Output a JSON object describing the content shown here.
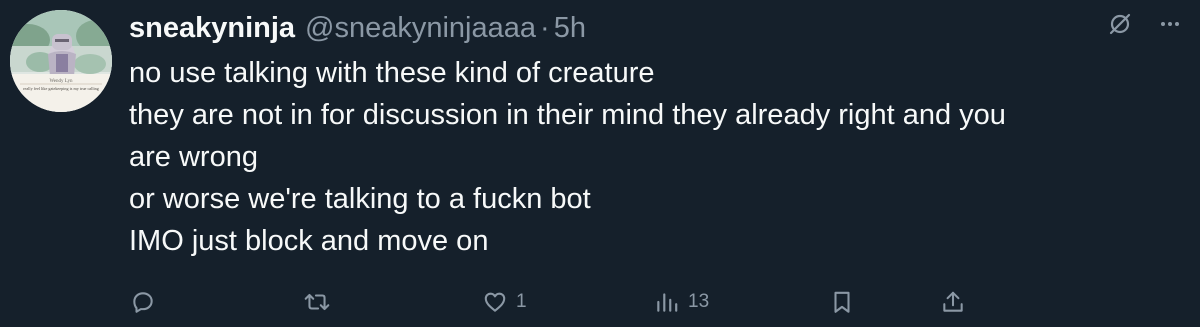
{
  "tweet": {
    "display_name": "sneakyninja",
    "handle": "@sneakyninjaaaa",
    "separator": "·",
    "time": "5h",
    "avatar_caption": "Wendy Lyn",
    "avatar_subcaption": "really feel like gatekeeping is my true calling",
    "lines": [
      "no use talking with these kind of creature",
      "they are not in for discussion in their mind they already right and you",
      "are wrong",
      "or worse we're talking to a fuckn bot",
      "IMO just block and move on"
    ]
  },
  "actions": {
    "reply_count": "",
    "retweet_count": "",
    "like_count": "1",
    "views_count": "13"
  },
  "icons": {
    "grok": "grok-icon",
    "more": "more-icon",
    "reply": "reply-icon",
    "retweet": "retweet-icon",
    "like": "like-icon",
    "views": "views-icon",
    "bookmark": "bookmark-icon",
    "share": "share-icon"
  },
  "colors": {
    "background": "#15202b",
    "text": "#f7f9f9",
    "muted": "#8b98a5"
  }
}
